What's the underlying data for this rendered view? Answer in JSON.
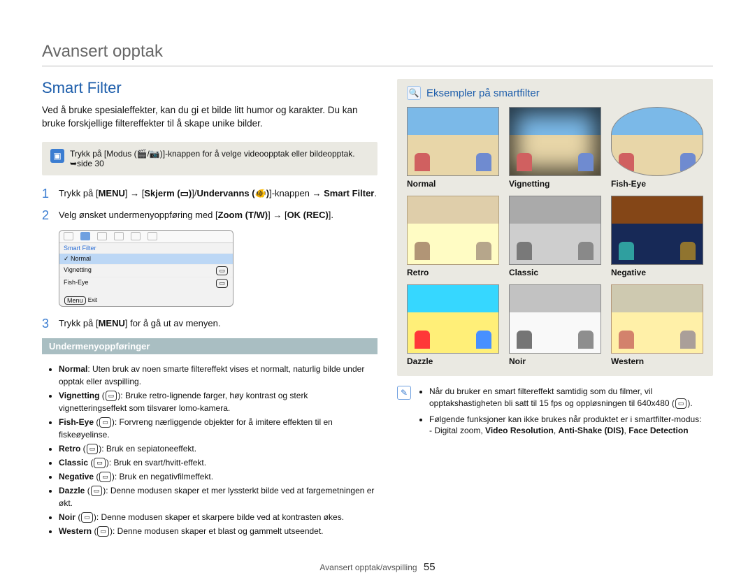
{
  "header": {
    "breadcrumb": "Avansert opptak"
  },
  "left": {
    "title": "Smart Filter",
    "intro": "Ved å bruke spesialeffekter, kan du gi et bilde litt humor og karakter. Du kan bruke forskjellige filtereffekter til å skape unike bilder.",
    "note": "Trykk på [Modus (🎬/📷)]-knappen for å velge videoopptak eller bildeopptak. ➥side 30",
    "steps": [
      {
        "n": "1",
        "parts": [
          "Trykk på [",
          "MENU",
          "] → [",
          "Skjerm (▭)",
          "]/",
          "Undervanns (🐠)",
          "]-knappen → ",
          "Smart Filter",
          "."
        ]
      },
      {
        "n": "2",
        "parts": [
          "Velg ønsket undermenyoppføring med [",
          "Zoom (T/W)",
          "] → [",
          "OK (REC)",
          "]."
        ]
      },
      {
        "n": "3",
        "parts": [
          "Trykk på [",
          "MENU",
          "] for å gå ut av menyen."
        ]
      }
    ],
    "screenshot": {
      "heading": "Smart Filter",
      "rows": [
        "Normal",
        "Vignetting",
        "Fish-Eye"
      ],
      "selected": "Normal",
      "exit": "Exit",
      "exit_btn": "Menu"
    },
    "sub_title": "Undermenyoppføringer",
    "sub_items": [
      {
        "name": "Normal",
        "icon": "",
        "desc": "Uten bruk av noen smarte filtereffekt vises et normalt, naturlig bilde under opptak eller avspilling."
      },
      {
        "name": "Vignetting",
        "icon": "▭",
        "desc": "Bruke retro-lignende farger, høy kontrast og sterk vignetteringseffekt som tilsvarer lomo-kamera."
      },
      {
        "name": "Fish-Eye",
        "icon": "▭",
        "desc": "Forvreng nærliggende objekter for å imitere effekten til en fiskeøyelinse."
      },
      {
        "name": "Retro",
        "icon": "▭",
        "desc": "Bruk en sepiatoneeffekt."
      },
      {
        "name": "Classic",
        "icon": "▭",
        "desc": "Bruk en svart/hvitt-effekt."
      },
      {
        "name": "Negative",
        "icon": "▭",
        "desc": "Bruk en negativfilmeffekt."
      },
      {
        "name": "Dazzle",
        "icon": "▭",
        "desc": "Denne modusen skaper et mer lyssterkt bilde ved at fargemetningen er økt."
      },
      {
        "name": "Noir",
        "icon": "▭",
        "desc": "Denne modusen skaper et skarpere bilde ved at kontrasten økes."
      },
      {
        "name": "Western",
        "icon": "▭",
        "desc": "Denne modusen skaper et blast og gammelt utseendet."
      }
    ]
  },
  "right": {
    "examples_title": "Eksempler på smartfilter",
    "thumbs": [
      {
        "label": "Normal",
        "cls": "normal"
      },
      {
        "label": "Vignetting",
        "cls": "vignette"
      },
      {
        "label": "Fish-Eye",
        "cls": "fisheye"
      },
      {
        "label": "Retro",
        "cls": "retro"
      },
      {
        "label": "Classic",
        "cls": "classic"
      },
      {
        "label": "Negative",
        "cls": "negative"
      },
      {
        "label": "Dazzle",
        "cls": "dazzle"
      },
      {
        "label": "Noir",
        "cls": "noir"
      },
      {
        "label": "Western",
        "cls": "western"
      }
    ],
    "notes": [
      {
        "text": "Når du bruker en smart filtereffekt samtidig som du filmer, vil opptakshastigheten bli satt til 15 fps og oppløsningen til 640x480 (",
        "suffix_icon": "▭",
        "suffix": ")."
      },
      {
        "text": "Følgende funksjoner kan ikke brukes når produktet er i smartfilter-modus:",
        "sub": "- Digital zoom, ",
        "bolds": [
          "Video Resolution",
          "Anti-Shake (DIS)",
          "Face Detection"
        ]
      }
    ]
  },
  "footer": {
    "label": "Avansert opptak/avspilling",
    "page": "55"
  }
}
